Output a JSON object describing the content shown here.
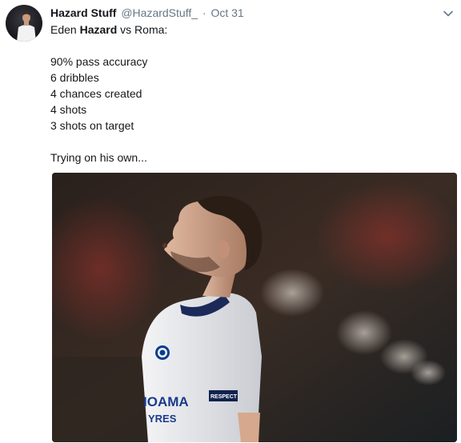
{
  "tweet": {
    "display_name": "Hazard Stuff",
    "handle": "@HazardStuff_",
    "separator": "·",
    "timestamp": "Oct 31",
    "lines": {
      "l1_pre": "Eden ",
      "l1_bold": "Hazard",
      "l1_post": " vs Roma:",
      "l2": "90% pass accuracy",
      "l3": "6 dribbles",
      "l4": "4 chances created",
      "l5": "4 shots",
      "l6": "3 shots on target",
      "l7": "Trying on his own..."
    },
    "photo": {
      "shirt_text_1": "IOAMA",
      "shirt_text_2": "YRES",
      "badge_text": "RESPECT"
    }
  },
  "icons": {
    "menu": "chevron-down-icon"
  },
  "colors": {
    "text_primary": "#14171a",
    "text_secondary": "#657786"
  }
}
